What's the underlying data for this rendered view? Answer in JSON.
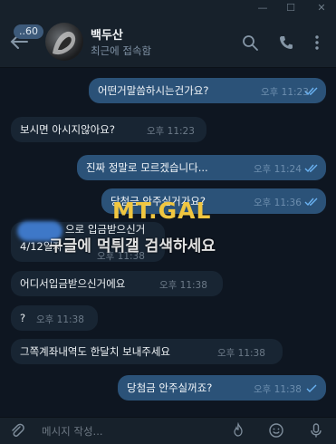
{
  "window": {
    "minimize_glyph": "—",
    "maximize_glyph": "☐",
    "close_glyph": "✕"
  },
  "header": {
    "unread_count": "..60",
    "contact_name": "백두산",
    "status": "최근에 접속함"
  },
  "messages": [
    {
      "dir": "out",
      "text": "어떤거말씀하시는건가요?",
      "time": "오후 11:23",
      "read": true
    },
    {
      "dir": "in",
      "text": "보시면 아시지않아요?",
      "time": "오후 11:23"
    },
    {
      "dir": "out",
      "text": "진짜 정말로 모르겠습니다...",
      "time": "오후 11:24",
      "read": true
    },
    {
      "dir": "out",
      "text": "당첨금 안주실거가요?",
      "time": "오후 11:36",
      "read": true
    },
    {
      "dir": "in",
      "text_line1": "으로 입금받으신거",
      "text_line2": "4/12일자",
      "time": "오후 11:38"
    },
    {
      "dir": "in",
      "text": "어디서입금받으신거에요",
      "time": "오후 11:38"
    },
    {
      "dir": "in",
      "text": "?",
      "time": "오후 11:38"
    },
    {
      "dir": "in",
      "text": "그쪽계좌내역도 한달치 보내주세요",
      "time": "오후 11:38"
    },
    {
      "dir": "out",
      "text": "당첨금 안주실꺼죠?",
      "time": "오후 11:38",
      "read": false
    }
  ],
  "watermark": {
    "logo": "MT.GAL",
    "text": "구글에 먹튀갤 검색하세요"
  },
  "composer": {
    "placeholder": "메시지 작성..."
  },
  "colors": {
    "background": "#0e1621",
    "header": "#17212b",
    "outgoing": "#2b5278",
    "incoming": "#182533"
  }
}
